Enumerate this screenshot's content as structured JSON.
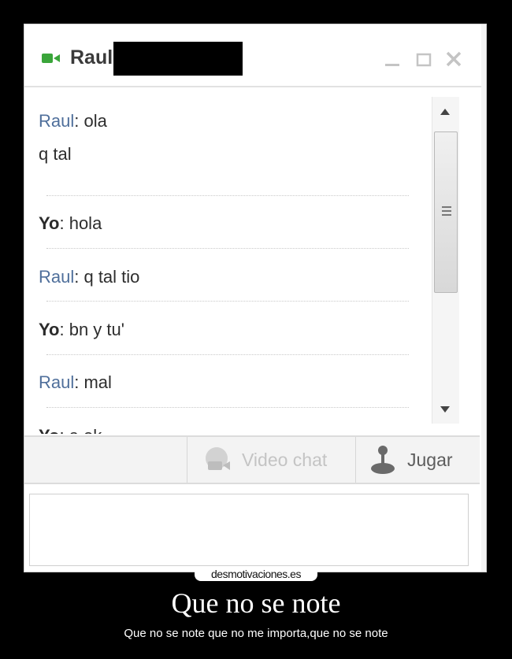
{
  "window": {
    "contact_name": "Raul",
    "status_icon": "videocam-icon",
    "controls": [
      "minimize-icon",
      "maximize-icon",
      "close-icon"
    ]
  },
  "messages": [
    {
      "sender": "Raul",
      "lines": [
        ": ola",
        "q tal"
      ]
    },
    {
      "sender": "Yo",
      "lines": [
        ": hola"
      ]
    },
    {
      "sender": "Raul",
      "lines": [
        ": q tal tio"
      ]
    },
    {
      "sender": "Yo",
      "lines": [
        ": bn y tu'"
      ]
    },
    {
      "sender": "Raul",
      "lines": [
        ": mal"
      ]
    },
    {
      "sender": "Yo",
      "lines": [
        ": a ok"
      ]
    }
  ],
  "toolbar": {
    "video_chat_label": "Video chat",
    "jugar_label": "Jugar"
  },
  "input": {
    "value": ""
  },
  "watermark": "desmotivaciones.es",
  "caption": {
    "title": "Que no se note",
    "subtitle": "Que no se note que no me importa,que no se note"
  },
  "colors": {
    "sender_raul": "#4f6f9b",
    "sender_yo": "#2b2b2b",
    "status_green": "#3aa53a",
    "disabled_text": "#c4c4c4"
  }
}
